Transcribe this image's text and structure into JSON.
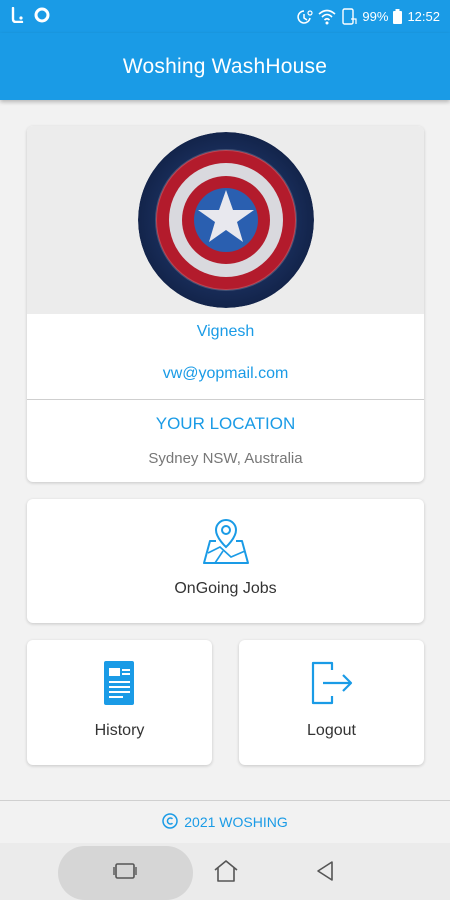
{
  "status_bar": {
    "battery": "99%",
    "time": "12:52",
    "left_icons": [
      "clean-master-icon",
      "circle-notification-icon"
    ],
    "right_icons": [
      "alarm-icon",
      "wifi-icon",
      "phone-icon",
      "battery-icon"
    ]
  },
  "app_bar": {
    "title": "Woshing WashHouse"
  },
  "profile": {
    "name": "Vignesh",
    "email": "vw@yopmail.com",
    "location_heading": "YOUR LOCATION",
    "location": "Sydney NSW, Australia",
    "avatar_icon": "captain-america-shield"
  },
  "menu": {
    "ongoing_label": "OnGoing Jobs",
    "history_label": "History",
    "logout_label": "Logout"
  },
  "footer": {
    "copyright_symbol": "©",
    "text": "2021 WOSHING"
  },
  "colors": {
    "primary": "#1a9be6",
    "background": "#f2f2f2"
  }
}
